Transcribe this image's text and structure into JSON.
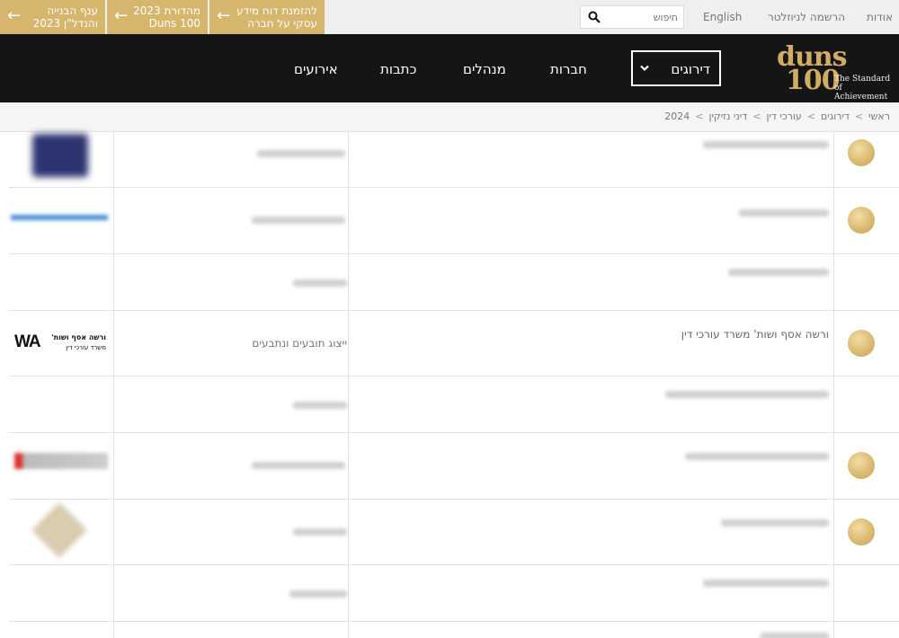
{
  "topbar": {
    "promos": [
      {
        "line1": "ענף הבנייה",
        "line2": "והנדל\"ן 2023"
      },
      {
        "line1": "מהדורת 2023",
        "line2": "Duns 100"
      },
      {
        "line1": "להזמנת דוח מידע",
        "line2": "עסקי על חברה"
      }
    ],
    "search_placeholder": "חיפוש",
    "links": {
      "english": "English",
      "newsletter": "הרשמה לניוזלטר",
      "about": "אודות"
    }
  },
  "nav": {
    "items": {
      "events": "אירועים",
      "writers": "כתבות",
      "managers": "מנהלים",
      "companies": "חברות"
    },
    "dropdown_label": "דירוגים",
    "logo": {
      "word1": "duns",
      "word2": "100",
      "tag1": "The Standard",
      "tag2": "of Achievement"
    }
  },
  "breadcrumb": [
    "ראשי",
    "דירוגים",
    "עורכי דין",
    "דיני נזיקין",
    "2024"
  ],
  "rows": [
    {
      "medal": true
    },
    {
      "medal": true
    },
    {
      "medal": false
    },
    {
      "medal": true,
      "firm": "ורשה אסף ושות' משרד עורכי דין",
      "specialty": "ייצוג תובעים ונתבעים",
      "logo": {
        "mark": "WA",
        "text1": "ורשה אסף ושות'",
        "text2": "משרד עורכי דין"
      }
    },
    {
      "medal": false
    },
    {
      "medal": true
    },
    {
      "medal": true
    },
    {
      "medal": false
    }
  ],
  "colors": {
    "gold": "#d6b56d",
    "nav_bg": "#151515"
  }
}
